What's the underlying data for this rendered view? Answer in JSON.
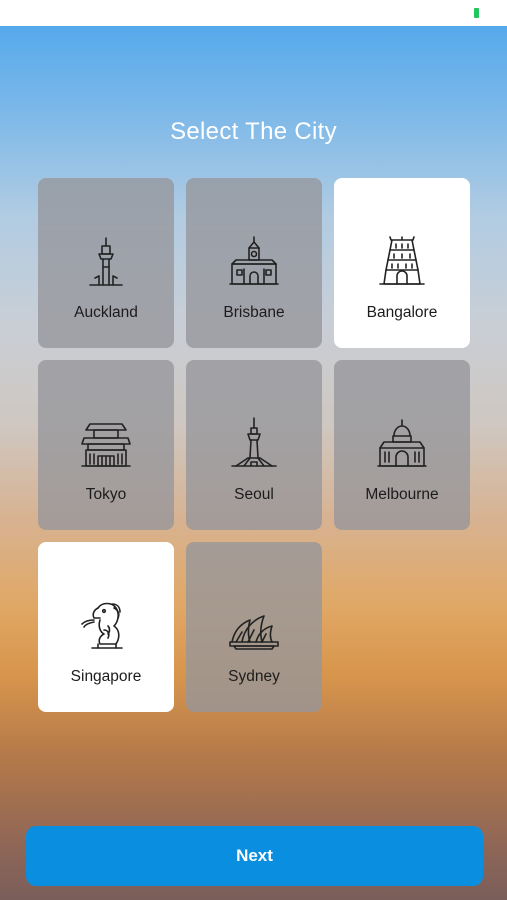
{
  "title": "Select The City",
  "cities": [
    {
      "label": "Auckland",
      "icon": "sky-tower-icon",
      "selected": false
    },
    {
      "label": "Brisbane",
      "icon": "city-hall-icon",
      "selected": false
    },
    {
      "label": "Bangalore",
      "icon": "temple-icon",
      "selected": true
    },
    {
      "label": "Tokyo",
      "icon": "pagoda-icon",
      "selected": false
    },
    {
      "label": "Seoul",
      "icon": "n-seoul-tower-icon",
      "selected": false
    },
    {
      "label": "Melbourne",
      "icon": "exhibition-building-icon",
      "selected": false
    },
    {
      "label": "Singapore",
      "icon": "merlion-icon",
      "selected": true
    },
    {
      "label": "Sydney",
      "icon": "opera-house-icon",
      "selected": false
    }
  ],
  "next_label": "Next",
  "colors": {
    "accent": "#0a8ee0",
    "card_selected": "#ffffff",
    "card_unselected": "#98989d",
    "battery": "#22c55e"
  }
}
